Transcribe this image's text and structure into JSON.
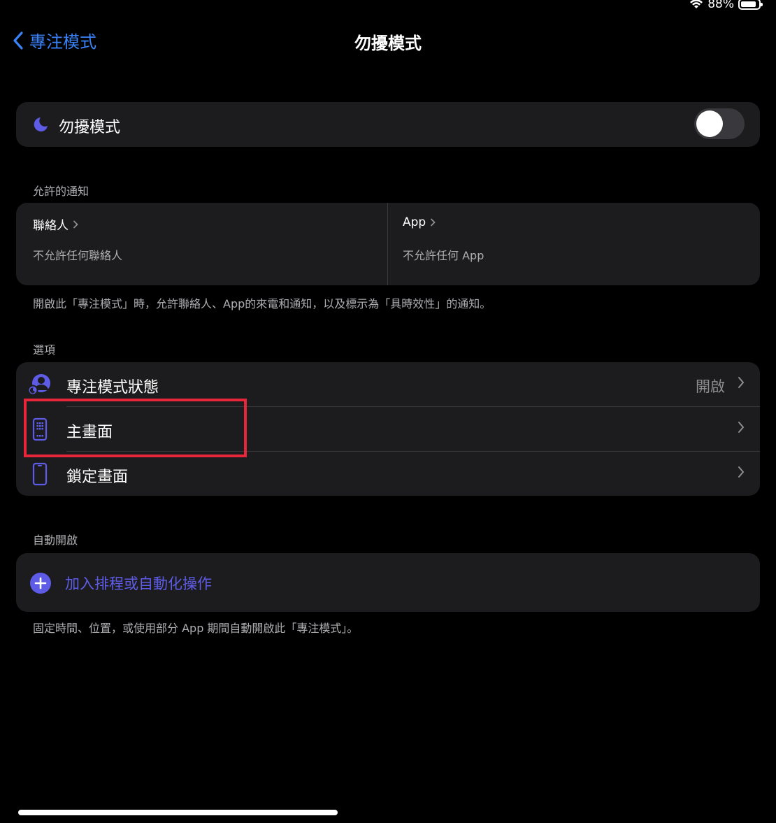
{
  "status_bar": {
    "battery": "88%",
    "battery_level": 0.88
  },
  "nav": {
    "back_label": "專注模式",
    "title": "勿擾模式"
  },
  "focus_toggle": {
    "label": "勿擾模式",
    "on": false
  },
  "allowed_notifications": {
    "section_label": "允許的通知",
    "people": {
      "title": "聯絡人",
      "subtitle": "不允許任何聯絡人"
    },
    "apps": {
      "title": "App",
      "subtitle": "不允許任何 App"
    },
    "footnote": "開啟此「專注模式」時，允許聯絡人、App的來電和通知，以及標示為「具時效性」的通知。"
  },
  "options": {
    "section_label": "選項",
    "items": [
      {
        "label": "專注模式狀態",
        "value": "開啟",
        "icon": "focus-status-icon"
      },
      {
        "label": "主畫面",
        "value": "",
        "icon": "home-screen-icon"
      },
      {
        "label": "鎖定畫面",
        "value": "",
        "icon": "lock-screen-icon"
      }
    ]
  },
  "auto_on": {
    "section_label": "自動開啟",
    "add_label": "加入排程或自動化操作",
    "footnote": "固定時間、位置，或使用部分 App 期間自動開啟此「專注模式」。"
  },
  "colors": {
    "accent": "#5e5ce6",
    "link": "#3a82f7",
    "highlight": "#e8263b"
  }
}
